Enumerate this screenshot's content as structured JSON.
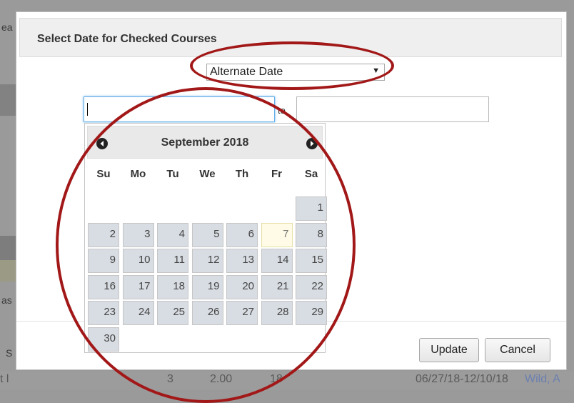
{
  "background": {
    "left_fragments": [
      "ea",
      "as",
      "S",
      "t l"
    ],
    "row_fragments": [
      "3",
      "2.00",
      "18",
      "06/27/18-12/10/18",
      "Wild, A"
    ]
  },
  "dialog": {
    "title": "Select Date for Checked Courses",
    "select": {
      "value": "Alternate Date",
      "arrow": "▼"
    },
    "to_label": "to",
    "buttons": {
      "update": "Update",
      "cancel": "Cancel"
    }
  },
  "datepicker": {
    "month_label": "September 2018",
    "weekdays": [
      "Su",
      "Mo",
      "Tu",
      "We",
      "Th",
      "Fr",
      "Sa"
    ],
    "days": [
      "1",
      "2",
      "3",
      "4",
      "5",
      "6",
      "7",
      "8",
      "9",
      "10",
      "11",
      "12",
      "13",
      "14",
      "15",
      "16",
      "17",
      "18",
      "19",
      "20",
      "21",
      "22",
      "23",
      "24",
      "25",
      "26",
      "27",
      "28",
      "29",
      "30"
    ],
    "first_weekday_index": 6,
    "today": "7"
  },
  "colors": {
    "annotation": "#a21818",
    "cell_bg": "#d8dde3",
    "today_bg": "#fffbe6",
    "focus_border": "#66afe9"
  },
  "icons": {
    "prev": "circle-arrow-left-icon",
    "next": "circle-arrow-right-icon"
  }
}
